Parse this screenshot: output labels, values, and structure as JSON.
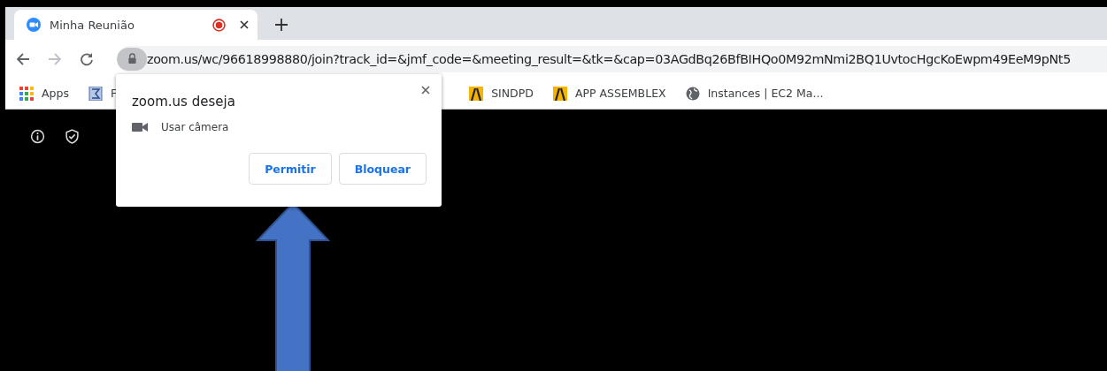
{
  "tab": {
    "title": "Minha Reunião",
    "recording": true
  },
  "address_bar": {
    "url": "zoom.us/wc/96618998880/join?track_id=&jmf_code=&meeting_result=&tk=&cap=03AGdBq26BfBIHQo0M92mNmi2BQ1UvtocHgcKoEwpm49EeM9pNt5"
  },
  "bookmarks": [
    {
      "label": "Apps",
      "kind": "apps"
    },
    {
      "label": "F",
      "kind": "doc"
    },
    {
      "label": "SINDPD",
      "kind": "yellow"
    },
    {
      "label": "APP ASSEMBLEX",
      "kind": "yellow"
    },
    {
      "label": "Instances | EC2 Ma...",
      "kind": "globe"
    }
  ],
  "permission_popup": {
    "title": "zoom.us deseja",
    "permission": "Usar câmera",
    "buttons": [
      "Permitir",
      "Bloquear"
    ]
  }
}
